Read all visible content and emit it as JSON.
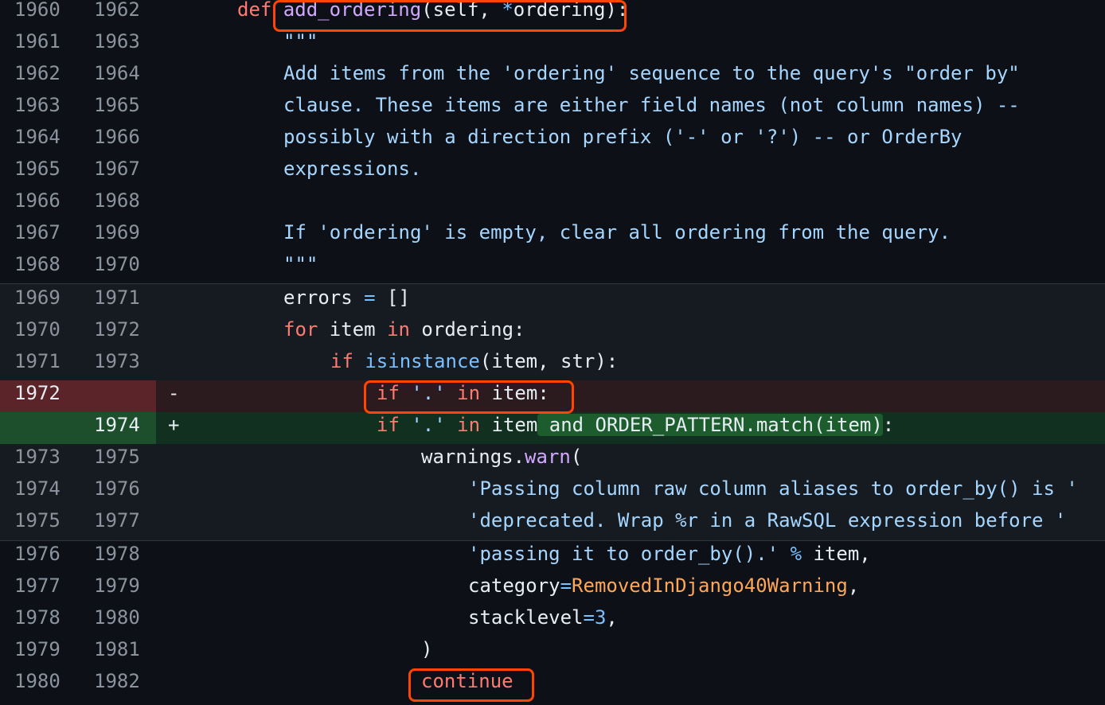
{
  "colors": {
    "background": "#161b22",
    "expanded_background": "#0d1117",
    "deleted_line_bg": "#2b1a1e",
    "deleted_gutter_bg": "#5a2428",
    "added_line_bg": "#12301f",
    "added_gutter_bg": "#1e4f2d",
    "highlight_box": "#ff4500"
  },
  "lines": [
    {
      "old": "1960",
      "new": "1962",
      "type": "expanded",
      "tokens": [
        {
          "t": "def ",
          "c": "kw"
        },
        {
          "t": "add_ordering",
          "c": "fn"
        },
        {
          "t": "(self, ",
          "c": "text"
        },
        {
          "t": "*",
          "c": "op"
        },
        {
          "t": "ordering):",
          "c": "text"
        }
      ]
    },
    {
      "old": "1961",
      "new": "1963",
      "type": "expanded",
      "tokens": [
        {
          "t": "\"\"\"",
          "c": "str"
        }
      ]
    },
    {
      "old": "1962",
      "new": "1964",
      "type": "expanded",
      "tokens": [
        {
          "t": "Add items from the 'ordering' sequence to the query's \"order by\"",
          "c": "str"
        }
      ]
    },
    {
      "old": "1963",
      "new": "1965",
      "type": "expanded",
      "tokens": [
        {
          "t": "clause. These items are either field names (not column names) --",
          "c": "str"
        }
      ]
    },
    {
      "old": "1964",
      "new": "1966",
      "type": "expanded",
      "tokens": [
        {
          "t": "possibly with a direction prefix ('-' or '?') -- or OrderBy",
          "c": "str"
        }
      ]
    },
    {
      "old": "1965",
      "new": "1967",
      "type": "expanded",
      "tokens": [
        {
          "t": "expressions.",
          "c": "str"
        }
      ]
    },
    {
      "old": "1966",
      "new": "1968",
      "type": "expanded",
      "tokens": []
    },
    {
      "old": "1967",
      "new": "1969",
      "type": "expanded",
      "tokens": [
        {
          "t": "If 'ordering' is empty, clear all ordering from the query.",
          "c": "str"
        }
      ]
    },
    {
      "old": "1968",
      "new": "1970",
      "type": "expanded",
      "tokens": [
        {
          "t": "\"\"\"",
          "c": "str"
        }
      ]
    },
    {
      "old": "1969",
      "new": "1971",
      "type": "context",
      "tokens": [
        {
          "t": "errors ",
          "c": "text"
        },
        {
          "t": "=",
          "c": "op"
        },
        {
          "t": " []",
          "c": "text"
        }
      ]
    },
    {
      "old": "1970",
      "new": "1972",
      "type": "context",
      "tokens": [
        {
          "t": "for",
          "c": "kw"
        },
        {
          "t": " item ",
          "c": "text"
        },
        {
          "t": "in",
          "c": "kw"
        },
        {
          "t": " ordering:",
          "c": "text"
        }
      ]
    },
    {
      "old": "1971",
      "new": "1973",
      "type": "context",
      "tokens": [
        {
          "t": "if ",
          "c": "kw"
        },
        {
          "t": "isinstance",
          "c": "const"
        },
        {
          "t": "(item, str):",
          "c": "text"
        }
      ]
    },
    {
      "old": "1972",
      "new": "",
      "sign": "-",
      "type": "deleted",
      "tokens": [
        {
          "t": "if ",
          "c": "kw"
        },
        {
          "t": "'.'",
          "c": "str"
        },
        {
          "t": " in ",
          "c": "kw"
        },
        {
          "t": "item:",
          "c": "text"
        }
      ]
    },
    {
      "old": "",
      "new": "1974",
      "sign": "+",
      "type": "added",
      "tokens": [
        {
          "t": "if ",
          "c": "kw"
        },
        {
          "t": "'.'",
          "c": "str"
        },
        {
          "t": " in ",
          "c": "kw"
        },
        {
          "t": "item",
          "c": "text"
        },
        {
          "t": " and ORDER_PATTERN.match(item)",
          "c": "hl"
        },
        {
          "t": ":",
          "c": "text"
        }
      ]
    },
    {
      "old": "1973",
      "new": "1975",
      "type": "context",
      "tokens": [
        {
          "t": "warnings.",
          "c": "text"
        },
        {
          "t": "warn",
          "c": "fn"
        },
        {
          "t": "(",
          "c": "text"
        }
      ]
    },
    {
      "old": "1974",
      "new": "1976",
      "type": "context",
      "tokens": [
        {
          "t": "'Passing column raw column aliases to order_by() is '",
          "c": "str"
        }
      ]
    },
    {
      "old": "1975",
      "new": "1977",
      "type": "context",
      "tokens": [
        {
          "t": "'deprecated. Wrap %r in a RawSQL expression before '",
          "c": "str"
        }
      ]
    },
    {
      "old": "1976",
      "new": "1978",
      "type": "expanded",
      "tokens": [
        {
          "t": "'passing it to order_by().'",
          "c": "str"
        },
        {
          "t": " % ",
          "c": "op"
        },
        {
          "t": "item,",
          "c": "text"
        }
      ]
    },
    {
      "old": "1977",
      "new": "1979",
      "type": "expanded",
      "tokens": [
        {
          "t": "category",
          "c": "text"
        },
        {
          "t": "=",
          "c": "op"
        },
        {
          "t": "RemovedInDjango40Warning",
          "c": "cls"
        },
        {
          "t": ",",
          "c": "text"
        }
      ]
    },
    {
      "old": "1978",
      "new": "1980",
      "type": "expanded",
      "tokens": [
        {
          "t": "stacklevel",
          "c": "text"
        },
        {
          "t": "=",
          "c": "op"
        },
        {
          "t": "3",
          "c": "const"
        },
        {
          "t": ",",
          "c": "text"
        }
      ]
    },
    {
      "old": "1979",
      "new": "1981",
      "type": "expanded",
      "tokens": [
        {
          "t": ")",
          "c": "text"
        }
      ]
    },
    {
      "old": "1980",
      "new": "1982",
      "type": "expanded",
      "tokens": [
        {
          "t": "continue",
          "c": "kw"
        }
      ]
    }
  ]
}
